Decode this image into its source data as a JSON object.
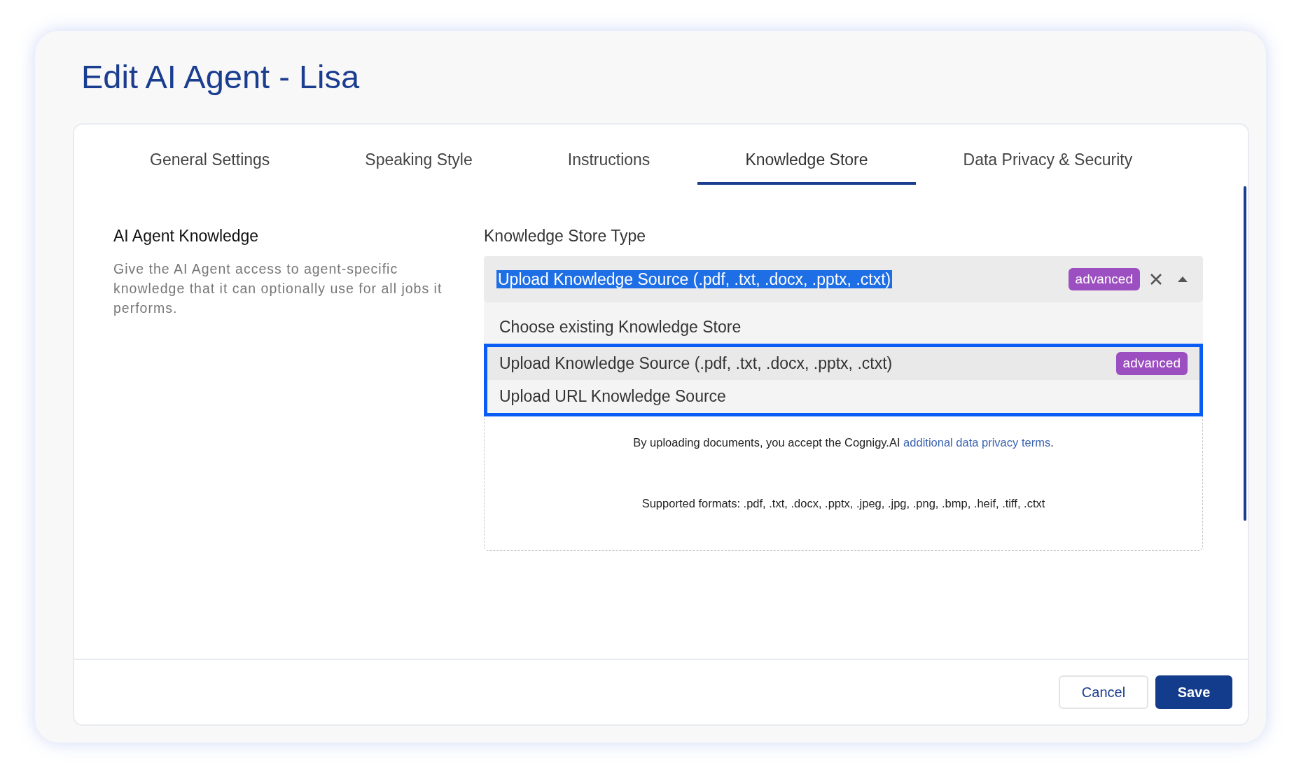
{
  "dialog": {
    "title": "Edit AI Agent - Lisa"
  },
  "tabs": [
    {
      "label": "General Settings",
      "selected": false
    },
    {
      "label": "Speaking Style",
      "selected": false
    },
    {
      "label": "Instructions",
      "selected": false
    },
    {
      "label": "Knowledge Store",
      "selected": true
    },
    {
      "label": "Data Privacy & Security",
      "selected": false
    }
  ],
  "section": {
    "title": "AI Agent Knowledge",
    "description": "Give the AI Agent access to agent-specific knowledge that it can optionally use for all jobs it performs."
  },
  "field": {
    "label": "Knowledge Store Type",
    "value": "Upload Knowledge Source (.pdf, .txt, .docx, .pptx, .ctxt)",
    "value_selected": true,
    "badge": "advanced",
    "expanded": true
  },
  "options": [
    {
      "label": "Choose existing Knowledge Store",
      "highlighted": false,
      "framed": false
    },
    {
      "label": "Upload Knowledge Source (.pdf, .txt, .docx, .pptx, .ctxt)",
      "badge": "advanced",
      "highlighted": true,
      "framed": true
    },
    {
      "label": "Upload URL Knowledge Source",
      "highlighted": false,
      "framed": true
    }
  ],
  "upload_area": {
    "notice": {
      "before": "By uploading documents, you accept the Cognigy.AI ",
      "link": "additional data privacy terms",
      "after": "."
    },
    "formats": "Supported formats: .pdf, .txt, .docx, .pptx, .jpeg, .jpg, .png, .bmp, .heif, .tiff, .ctxt"
  },
  "buttons": [
    {
      "label": "Cancel",
      "kind": "secondary"
    },
    {
      "label": "Save",
      "kind": "primary"
    }
  ]
}
